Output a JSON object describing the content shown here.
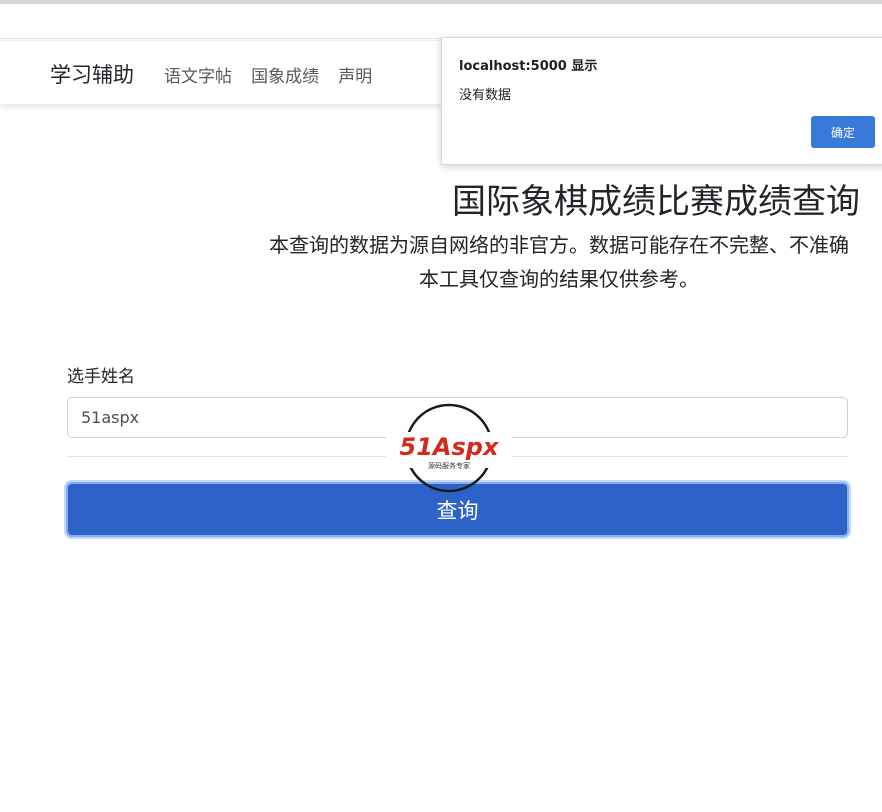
{
  "navbar": {
    "brand": "学习辅助",
    "links": [
      {
        "label": "语文字帖"
      },
      {
        "label": "国象成绩"
      },
      {
        "label": "声明"
      }
    ]
  },
  "alert_dialog": {
    "title": "localhost:5000 显示",
    "message": "没有数据",
    "ok_label": "确定",
    "ok_color": "#3879d9"
  },
  "hero": {
    "title": "国际象棋成绩比赛成绩查询",
    "line1": "本查询的数据为源自网络的非官方。数据可能存在不完整、不准确",
    "line2": "本工具仅查询的结果仅供参考。"
  },
  "form": {
    "name_label": "选手姓名",
    "name_value": "51aspx",
    "submit_label": "查询",
    "submit_color": "#2d63c8"
  },
  "watermark": {
    "logo_text": "51Aspx",
    "tagline": "源码服务专家"
  }
}
